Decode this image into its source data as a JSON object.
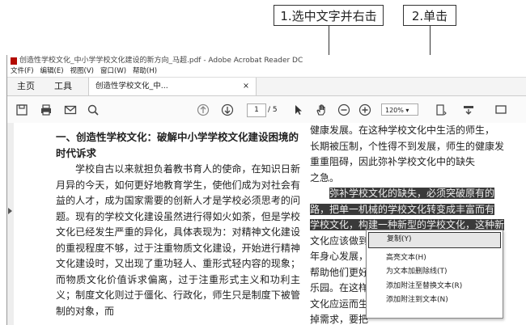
{
  "callouts": {
    "step1": "1.选中文字并右击",
    "step2": "2.单击"
  },
  "window": {
    "title": "创造性学校文化_中小学学校文化建设的新方向_马超.pdf - Adobe Acrobat Reader DC",
    "menu": [
      "文件(F)",
      "编辑(E)",
      "视图(V)",
      "窗口(W)",
      "帮助(H)"
    ],
    "tabs": {
      "home": "主页",
      "tools": "工具",
      "document": "创造性学校文化_中...",
      "close": "×"
    },
    "toolbar": {
      "page_current": "1",
      "page_total": "/ 5",
      "zoom": "120%"
    }
  },
  "document": {
    "heading": "一、创造性学校文化：破解中小学学校文化建设困境的时代诉求",
    "paragraph": "学校自古以来就担负着教书育人的使命，在知识日新月异的今天，如何更好地教育学生，使他们成为对社会有益的人才，成为国家需要的创新人才是学校必须思考的问题。现有的学校文化建设虽然进行得如火如荼，但是学校文化已经发生严重的异化，具体表现为：对精神文化建设的重视程度不够，过于注重物质文化建设，开始进行精神文化建设时，又出现了重功轻人、重形式轻内容的现象；而物质文化价值诉求偏离，过于注重形式主义和功利主义；制度文化则过于僵化、行政化，师生只是制度下被管制的对象，而",
    "right_lines": [
      "健康发展。在这种学校文化中生活的师生，",
      "长期被压制，个性得不到发展，师生的健康发",
      "重重阻碍，因此弥补学校文化中的缺失",
      "之急。"
    ],
    "selected_lines": [
      "弥补学校文化的缺失，必须突破原有的",
      "路，把单一机械的学校文化转变成丰富而有",
      "学校文化，构建一种新型的学校文化，这种新"
    ],
    "after_lines": [
      "文化应该做到",
      "年身心发展，",
      "帮助他们更好",
      "乐园。在这样",
      "文化应运而生",
      "掉需求，要把"
    ]
  },
  "context_menu": {
    "items": [
      "复制(Y)",
      "高亮文本(H)",
      "为文本加删除线(T)",
      "添加附注至替换文本(R)",
      "添加附注到文本(N)"
    ]
  }
}
